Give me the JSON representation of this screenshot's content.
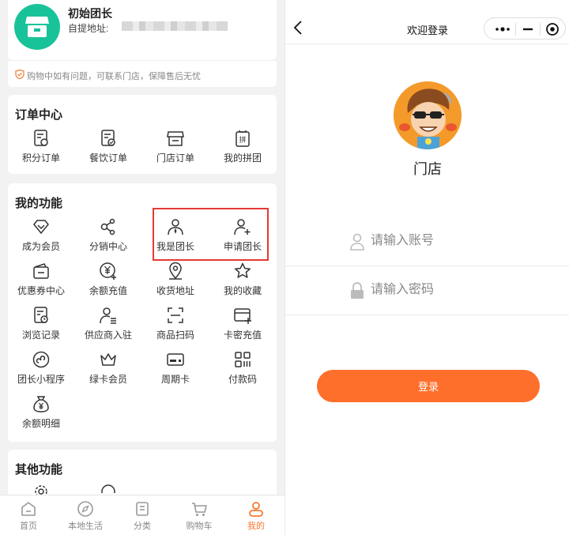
{
  "profile": {
    "name": "初始团长",
    "pickup_label": "自提地址:",
    "notice": "购物中如有问题，可联系门店，保障售后无忧"
  },
  "orders": {
    "title": "订单中心",
    "items": [
      {
        "label": "积分订单",
        "icon": "points-order-icon"
      },
      {
        "label": "餐饮订单",
        "icon": "food-order-icon"
      },
      {
        "label": "门店订单",
        "icon": "store-order-icon"
      },
      {
        "label": "我的拼团",
        "icon": "group-buy-icon"
      }
    ]
  },
  "functions": {
    "title": "我的功能",
    "items": [
      {
        "label": "成为会员",
        "icon": "diamond-icon"
      },
      {
        "label": "分销中心",
        "icon": "share-icon"
      },
      {
        "label": "我是团长",
        "icon": "leader-icon"
      },
      {
        "label": "申请团长",
        "icon": "add-user-icon"
      },
      {
        "label": "优惠券中心",
        "icon": "coupon-icon"
      },
      {
        "label": "余额充值",
        "icon": "yuan-plus-icon"
      },
      {
        "label": "收货地址",
        "icon": "location-icon"
      },
      {
        "label": "我的收藏",
        "icon": "star-icon"
      },
      {
        "label": "浏览记录",
        "icon": "history-icon"
      },
      {
        "label": "供应商入驻",
        "icon": "supplier-icon"
      },
      {
        "label": "商品扫码",
        "icon": "scan-icon"
      },
      {
        "label": "卡密充值",
        "icon": "card-plus-icon"
      },
      {
        "label": "团长小程序",
        "icon": "mini-program-icon"
      },
      {
        "label": "绿卡会员",
        "icon": "crown-icon"
      },
      {
        "label": "周期卡",
        "icon": "period-card-icon"
      },
      {
        "label": "付款码",
        "icon": "pay-code-icon"
      },
      {
        "label": "余额明细",
        "icon": "money-bag-icon"
      }
    ]
  },
  "other": {
    "title": "其他功能"
  },
  "tabbar": [
    {
      "label": "首页",
      "icon": "home-icon",
      "active": false
    },
    {
      "label": "本地生活",
      "icon": "compass-icon",
      "active": false
    },
    {
      "label": "分类",
      "icon": "category-icon",
      "active": false
    },
    {
      "label": "购物车",
      "icon": "cart-icon",
      "active": false
    },
    {
      "label": "我的",
      "icon": "user-icon",
      "active": true
    }
  ],
  "login": {
    "nav_title": "欢迎登录",
    "store_name": "门店",
    "account_placeholder": "请输入账号",
    "password_placeholder": "请输入密码",
    "login_button": "登录"
  },
  "colors": {
    "accent": "#ff6f2c",
    "avatar_bg": "#19c39a",
    "highlight": "#e53935",
    "active_tab": "#f47a30"
  }
}
